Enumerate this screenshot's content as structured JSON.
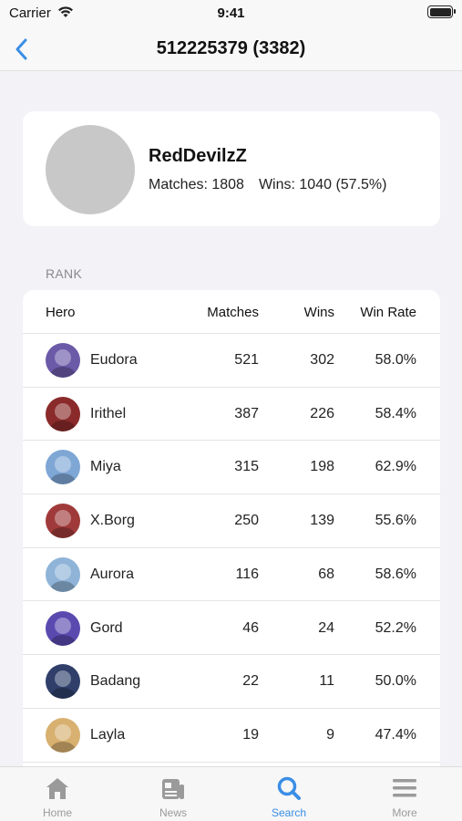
{
  "status_bar": {
    "carrier": "Carrier",
    "time": "9:41"
  },
  "nav": {
    "title": "512225379 (3382)"
  },
  "profile": {
    "name": "RedDevilzZ",
    "matches": "Matches: 1808",
    "wins": "Wins: 1040 (57.5%)"
  },
  "rank": {
    "section_label": "RANK",
    "headers": {
      "hero": "Hero",
      "matches": "Matches",
      "wins": "Wins",
      "win_rate": "Win Rate"
    },
    "rows": [
      {
        "hero": "Eudora",
        "matches": "521",
        "wins": "302",
        "win_rate": "58.0%",
        "icon_color": "#6b5aa8"
      },
      {
        "hero": "Irithel",
        "matches": "387",
        "wins": "226",
        "win_rate": "58.4%",
        "icon_color": "#8a2a2a"
      },
      {
        "hero": "Miya",
        "matches": "315",
        "wins": "198",
        "win_rate": "62.9%",
        "icon_color": "#7fa7d6"
      },
      {
        "hero": "X.Borg",
        "matches": "250",
        "wins": "139",
        "win_rate": "55.6%",
        "icon_color": "#a03a3a"
      },
      {
        "hero": "Aurora",
        "matches": "116",
        "wins": "68",
        "win_rate": "58.6%",
        "icon_color": "#8fb4d8"
      },
      {
        "hero": "Gord",
        "matches": "46",
        "wins": "24",
        "win_rate": "52.2%",
        "icon_color": "#5a4ab0"
      },
      {
        "hero": "Badang",
        "matches": "22",
        "wins": "11",
        "win_rate": "50.0%",
        "icon_color": "#2f3f6a"
      },
      {
        "hero": "Layla",
        "matches": "19",
        "wins": "9",
        "win_rate": "47.4%",
        "icon_color": "#d8b070"
      }
    ]
  },
  "tabs": [
    {
      "label": "Home",
      "icon": "home-icon",
      "active": false
    },
    {
      "label": "News",
      "icon": "news-icon",
      "active": false
    },
    {
      "label": "Search",
      "icon": "search-icon",
      "active": true
    },
    {
      "label": "More",
      "icon": "menu-icon",
      "active": false
    }
  ],
  "colors": {
    "accent": "#3a8ee6",
    "inactive": "#9a9a9a",
    "background": "#f2f2f7"
  }
}
